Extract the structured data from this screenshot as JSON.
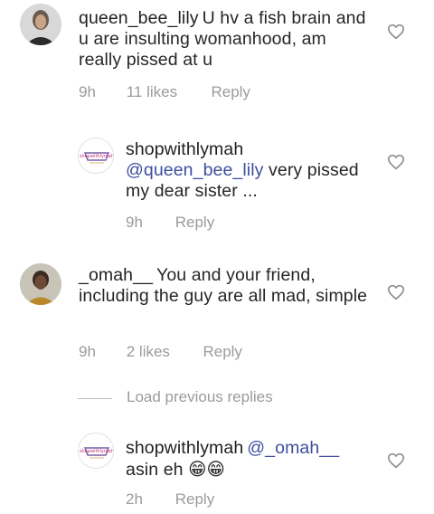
{
  "comments": [
    {
      "username": "queen_bee_lily",
      "text": "U hv a fish brain and u are insulting womanhood, am really pissed at u",
      "time": "9h",
      "likes": "11 likes",
      "reply": "Reply",
      "avatar_icon": "profile-photo"
    },
    {
      "username": "shopwithlymah",
      "mention": "@queen_bee_lily",
      "text": "very pissed my dear sister ...",
      "time": "9h",
      "reply": "Reply",
      "avatar_icon": "shopwithlymah-logo"
    },
    {
      "username": "_omah__",
      "text": "You and your friend, including the guy are all mad, simple",
      "time": "9h",
      "likes": "2 likes",
      "reply": "Reply",
      "avatar_icon": "profile-photo"
    },
    {
      "username": "shopwithlymah",
      "mention": "@_omah__",
      "text": "asin eh",
      "emoji": "😁😁",
      "time": "2h",
      "reply": "Reply",
      "avatar_icon": "shopwithlymah-logo"
    }
  ],
  "load_previous": "Load previous replies",
  "colors": {
    "text": "#262626",
    "meta": "#9b9b9b",
    "mention": "#3d4f9e"
  }
}
